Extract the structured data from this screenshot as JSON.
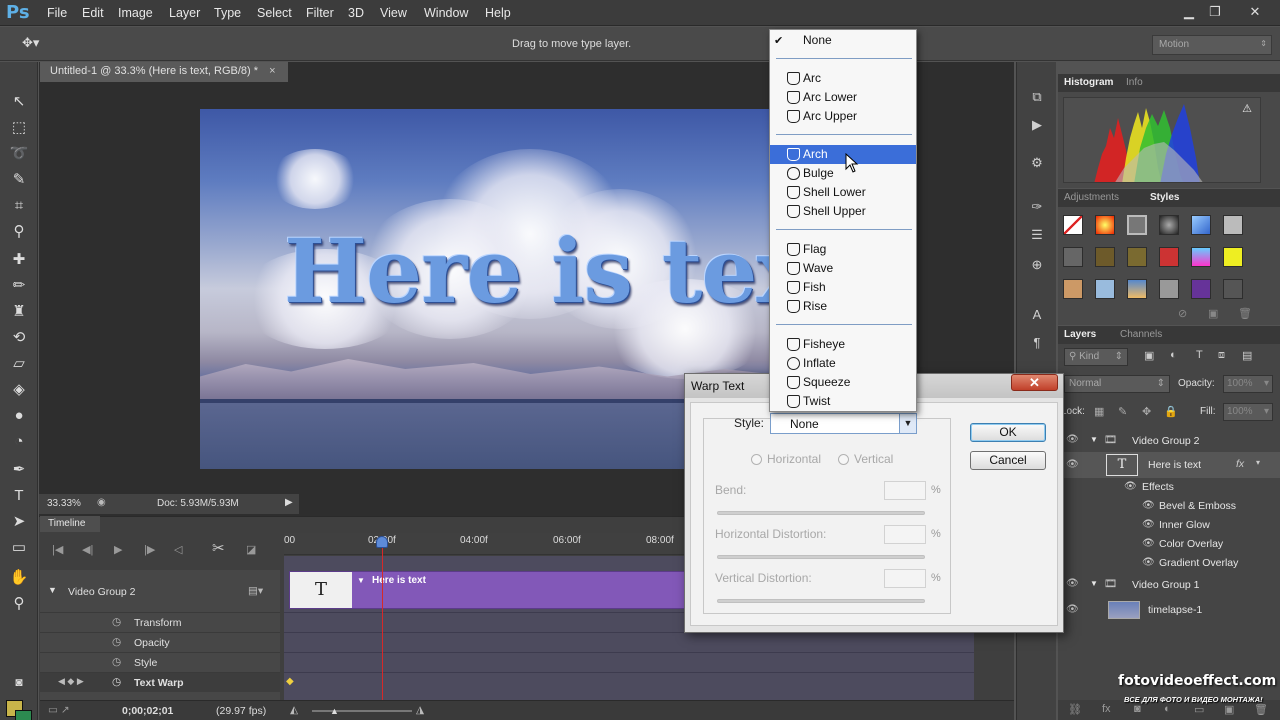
{
  "app": {
    "logo": "Ps",
    "menus": [
      "File",
      "Edit",
      "Image",
      "Layer",
      "Type",
      "Select",
      "Filter",
      "3D",
      "View",
      "Window",
      "Help"
    ],
    "window_controls": [
      "▁",
      "❐",
      "✕"
    ]
  },
  "options_bar": {
    "hint": "Drag to move type layer.",
    "workspace": "Motion"
  },
  "document": {
    "tab_title": "Untitled-1 @ 33.3% (Here is text, RGB/8) *",
    "close_glyph": "×",
    "canvas_text": "Here is text",
    "zoom": "33.33%",
    "doc_size": "Doc: 5.93M/5.93M"
  },
  "timeline": {
    "tab": "Timeline",
    "ruler_ticks": [
      "00",
      "02:00f",
      "04:00f",
      "06:00f",
      "08:00f"
    ],
    "group": "Video Group 2",
    "properties": [
      "Transform",
      "Opacity",
      "Style",
      "Text Warp"
    ],
    "clip_label": "Here is text",
    "clip_thumb": "T",
    "timecode": "0;00;02;01",
    "fps": "(29.97 fps)"
  },
  "panels": {
    "histogram_tabs": [
      "Histogram",
      "Info"
    ],
    "style_tabs": [
      "Adjustments",
      "Styles"
    ],
    "layer_tabs": [
      "Layers",
      "Channels"
    ],
    "kind_label": "Kind",
    "blend_mode": "Normal",
    "opacity_label": "Opacity:",
    "opacity_value": "100%",
    "lock_label": "Lock:",
    "fill_label": "Fill:",
    "fill_value": "100%",
    "layers": [
      {
        "name": "Video Group 2",
        "type": "group"
      },
      {
        "name": "Here is text",
        "type": "text",
        "fx": "fx"
      },
      {
        "name": "Effects",
        "type": "effects"
      },
      {
        "name": "Bevel & Emboss",
        "type": "effect"
      },
      {
        "name": "Inner Glow",
        "type": "effect"
      },
      {
        "name": "Color Overlay",
        "type": "effect"
      },
      {
        "name": "Gradient Overlay",
        "type": "effect"
      },
      {
        "name": "Video Group 1",
        "type": "group"
      },
      {
        "name": "timelapse-1",
        "type": "video"
      }
    ]
  },
  "warp_menu": {
    "items": [
      {
        "label": "None",
        "checked": true
      },
      {
        "label": "Arc"
      },
      {
        "label": "Arc Lower"
      },
      {
        "label": "Arc Upper"
      },
      {
        "label": "Arch",
        "highlighted": true
      },
      {
        "label": "Bulge"
      },
      {
        "label": "Shell Lower"
      },
      {
        "label": "Shell Upper"
      },
      {
        "label": "Flag"
      },
      {
        "label": "Wave"
      },
      {
        "label": "Fish"
      },
      {
        "label": "Rise"
      },
      {
        "label": "Fisheye"
      },
      {
        "label": "Inflate"
      },
      {
        "label": "Squeeze"
      },
      {
        "label": "Twist"
      }
    ],
    "check_glyph": "✔"
  },
  "warp_dialog": {
    "title": "Warp Text",
    "style_label": "Style:",
    "style_value": "None",
    "horizontal": "Horizontal",
    "vertical": "Vertical",
    "bend_label": "Bend:",
    "hdist_label": "Horizontal Distortion:",
    "vdist_label": "Vertical Distortion:",
    "percent": "%",
    "ok": "OK",
    "cancel": "Cancel",
    "close_glyph": "✕"
  },
  "watermark": {
    "brand": "fotovideoeffect.com",
    "tagline": "ВСЕ ДЛЯ ФОТО И ВИДЕО МОНТАЖА!"
  },
  "colors": {
    "accent_selection": "#3b6ed9",
    "clip_purple": "#8258b8",
    "playhead_red": "#d62929",
    "foreground_swatch": "#c8b44a",
    "background_swatch": "#2c8a50"
  }
}
